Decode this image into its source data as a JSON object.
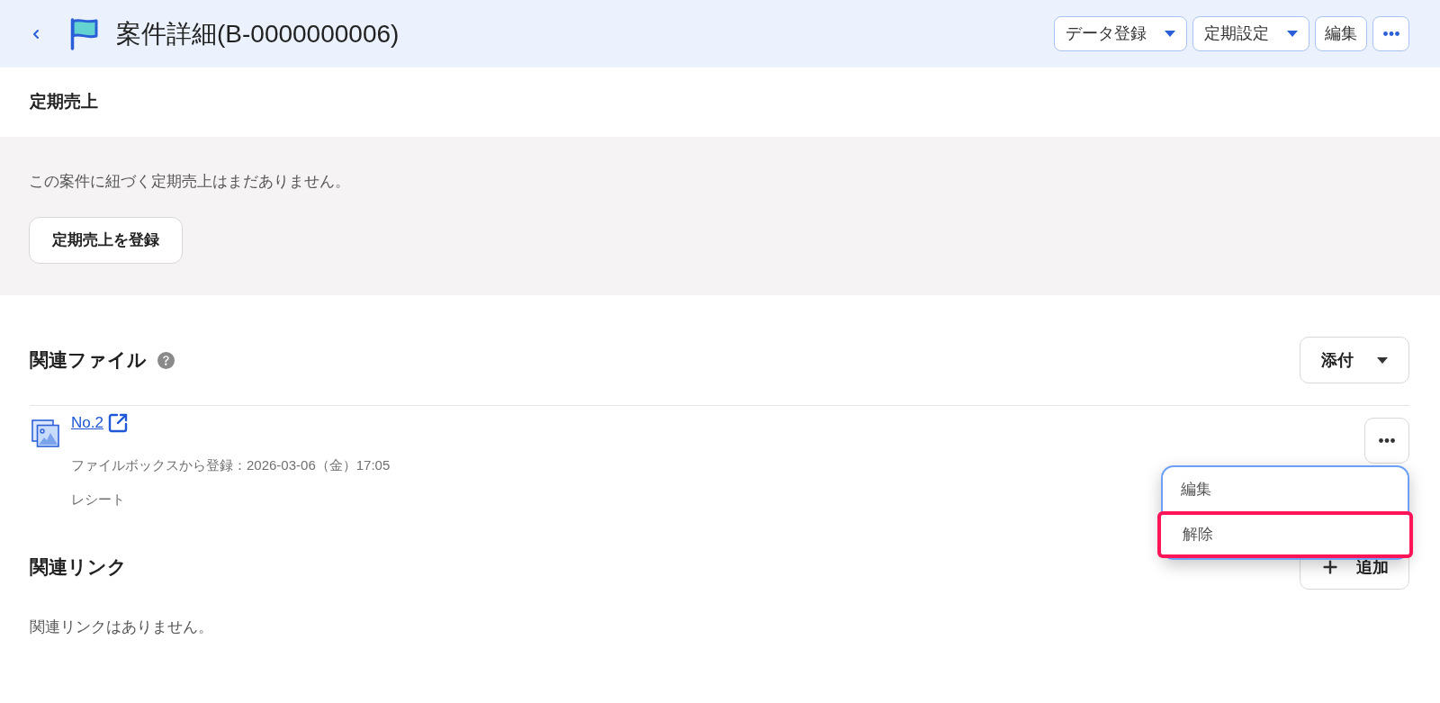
{
  "header": {
    "title": "案件詳細(B-0000000006)",
    "actions": [
      {
        "kind": "dropdown",
        "label": "データ登録"
      },
      {
        "kind": "dropdown",
        "label": "定期設定"
      },
      {
        "kind": "button",
        "label": "編集"
      },
      {
        "kind": "more"
      }
    ]
  },
  "recurring_sales": {
    "title": "定期売上",
    "empty_message": "この案件に紐づく定期売上はまだありません。",
    "register_button": "定期売上を登録"
  },
  "related_files": {
    "title": "関連ファイル",
    "attach_button": "添付",
    "files": [
      {
        "name": "No.2",
        "meta": "ファイルボックスから登録：2026-03-06（金）17:05",
        "tag": "レシート",
        "menu": {
          "items": [
            {
              "label": "編集",
              "selected": false
            },
            {
              "label": "解除",
              "selected": true
            }
          ]
        }
      }
    ]
  },
  "related_links": {
    "title": "関連リンク",
    "add_button": "追加",
    "empty_message": "関連リンクはありません。"
  }
}
